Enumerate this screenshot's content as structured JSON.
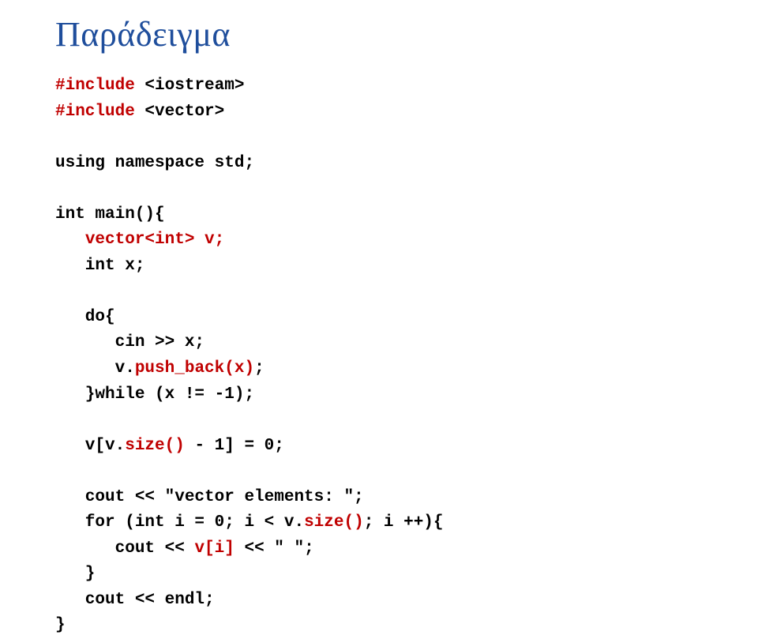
{
  "title": "Παράδειγμα",
  "code": {
    "l1a": "#include",
    "l1b": " <iostream>",
    "l2a": "#include",
    "l2b": " <vector>",
    "l3": "",
    "l4": "using namespace std;",
    "l5": "",
    "l6": "int main(){",
    "l7a": "   ",
    "l7b": "vector<int> v;",
    "l8": "   int x;",
    "l9": "",
    "l10": "   do{",
    "l11": "      cin >> x;",
    "l12a": "      v.",
    "l12b": "push_back(x)",
    "l12c": ";",
    "l13": "   }while (x != -1);",
    "l14": "",
    "l15a": "   v[v.",
    "l15b": "size()",
    "l15c": " - 1] = 0;",
    "l16": "",
    "l17": "   cout << \"vector elements: \";",
    "l18a": "   for (int i = 0; i < v.",
    "l18b": "size()",
    "l18c": "; i ++){",
    "l19a": "      cout << ",
    "l19b": "v[i]",
    "l19c": " << \" \";",
    "l20": "   }",
    "l21": "   cout << endl;",
    "l22": "}"
  }
}
